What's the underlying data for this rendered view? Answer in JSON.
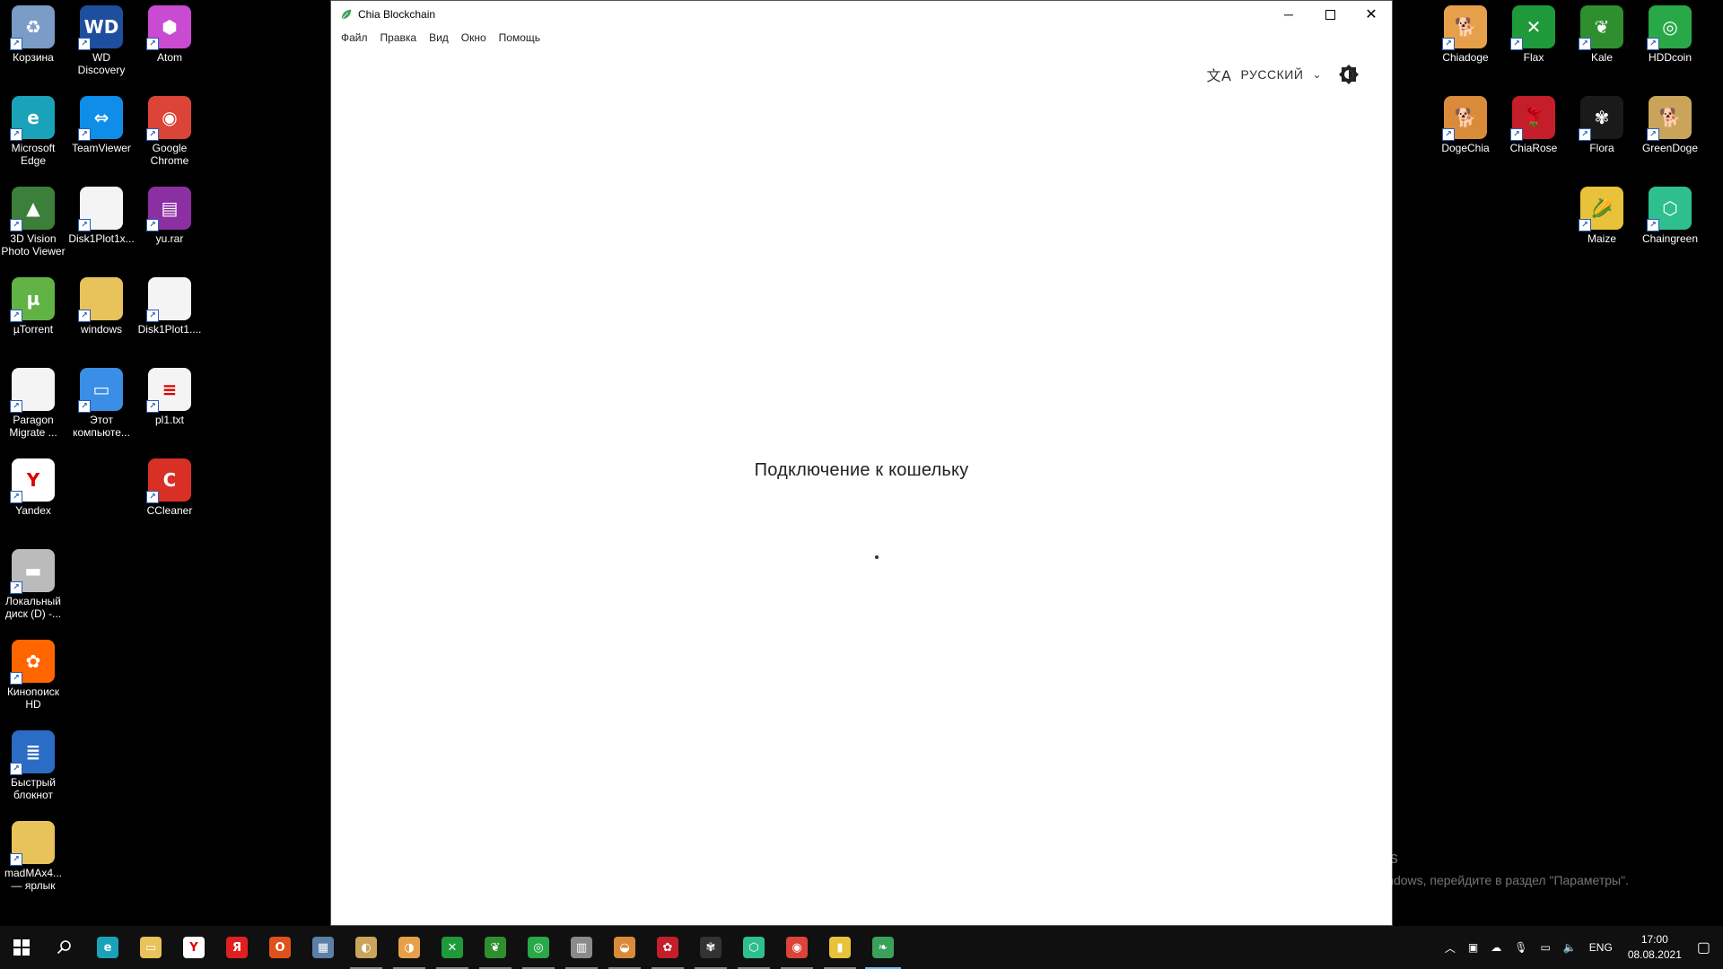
{
  "desktop_left": [
    {
      "label": "Корзина",
      "icon": "recycle-bin-icon",
      "color": "#7a9cc6",
      "glyph": "♻"
    },
    {
      "label": "WD Discovery",
      "icon": "wd-discovery-icon",
      "color": "#1e4e9e",
      "glyph": "WD"
    },
    {
      "label": "Atom",
      "icon": "atom-icon",
      "color": "#c84bd1",
      "glyph": "⬢"
    },
    {
      "label": "Microsoft Edge",
      "icon": "edge-icon",
      "color": "#1aa3b8",
      "glyph": "e"
    },
    {
      "label": "TeamViewer",
      "icon": "teamviewer-icon",
      "color": "#0e8ee9",
      "glyph": "⇔"
    },
    {
      "label": "Google Chrome",
      "icon": "chrome-icon",
      "color": "#db4437",
      "glyph": "◉"
    },
    {
      "label": "3D Vision Photo Viewer",
      "icon": "3d-vision-icon",
      "color": "#3b7f3b",
      "glyph": "▲"
    },
    {
      "label": "Disk1Plot1x...",
      "icon": "document-icon",
      "color": "#f4f4f4",
      "glyph": ""
    },
    {
      "label": "yu.rar",
      "icon": "winrar-icon",
      "color": "#8b2fa3",
      "glyph": "▤"
    },
    {
      "label": "µTorrent",
      "icon": "utorrent-icon",
      "color": "#62b346",
      "glyph": "µ"
    },
    {
      "label": "windows",
      "icon": "folder-icon",
      "color": "#e8c25a",
      "glyph": ""
    },
    {
      "label": "Disk1Plot1....",
      "icon": "document-icon",
      "color": "#f4f4f4",
      "glyph": ""
    },
    {
      "label": "Paragon Migrate ...",
      "icon": "document-icon",
      "color": "#f4f4f4",
      "glyph": ""
    },
    {
      "label": "Этот компьюте...",
      "icon": "computer-icon",
      "color": "#3a8ee6",
      "glyph": "▭"
    },
    {
      "label": "pl1.txt",
      "icon": "text-file-icon",
      "color": "#f4f4f4",
      "glyph": "≡"
    },
    {
      "label": "Yandex",
      "icon": "yandex-icon",
      "color": "#ffffff",
      "glyph": "Y"
    },
    {
      "label": "CCleaner",
      "icon": "ccleaner-icon",
      "color": "#d93025",
      "glyph": "C"
    },
    {
      "label": "Локальный диск (D) -...",
      "icon": "drive-icon",
      "color": "#bbbbbb",
      "glyph": "▬"
    },
    {
      "label": "Кинопоиск HD",
      "icon": "kinopoisk-icon",
      "color": "#ff6600",
      "glyph": "✿"
    },
    {
      "label": "Быстрый блокнот",
      "icon": "notepad-icon",
      "color": "#2b6cc4",
      "glyph": "≣"
    },
    {
      "label": "madMAx4... — ярлык",
      "icon": "folder-icon",
      "color": "#e8c25a",
      "glyph": ""
    }
  ],
  "desktop_right": [
    {
      "label": "Chiadoge",
      "icon": "chiadoge-icon",
      "color": "#e7a04a",
      "glyph": "🐕"
    },
    {
      "label": "Flax",
      "icon": "flax-icon",
      "color": "#1f9a3a",
      "glyph": "✕"
    },
    {
      "label": "Kale",
      "icon": "kale-icon",
      "color": "#2f8f2f",
      "glyph": "❦"
    },
    {
      "label": "HDDcoin",
      "icon": "hddcoin-icon",
      "color": "#29a847",
      "glyph": "◎"
    },
    {
      "label": "DogeChia",
      "icon": "dogechia-icon",
      "color": "#d98b3a",
      "glyph": "🐕"
    },
    {
      "label": "ChiaRose",
      "icon": "chiarose-icon",
      "color": "#c41e2a",
      "glyph": "🌹"
    },
    {
      "label": "Flora",
      "icon": "flora-icon",
      "color": "#1a1a1a",
      "glyph": "✾"
    },
    {
      "label": "GreenDoge",
      "icon": "greendoge-icon",
      "color": "#c9a45a",
      "glyph": "🐕"
    },
    {
      "label": "Maize",
      "icon": "maize-icon",
      "color": "#e8c23a",
      "glyph": "🌽"
    },
    {
      "label": "Chaingreen",
      "icon": "chaingreen-icon",
      "color": "#2fbf8f",
      "glyph": "⬡"
    }
  ],
  "window": {
    "title": "Chia Blockchain",
    "menu": [
      "Файл",
      "Правка",
      "Вид",
      "Окно",
      "Помощь"
    ],
    "language_label": "РУССКИЙ",
    "status_text": "Подключение к кошельку"
  },
  "watermark": {
    "heading": "Активация Windows",
    "sub": "Чтобы активировать Windows, перейдите в раздел \"Параметры\"."
  },
  "taskbar": {
    "apps": [
      {
        "name": "taskbar-edge",
        "color": "#1aa3b8",
        "glyph": "e"
      },
      {
        "name": "taskbar-explorer",
        "color": "#e8c25a",
        "glyph": "▭"
      },
      {
        "name": "taskbar-yandex-browser",
        "color": "#ffffff",
        "glyph": "Y"
      },
      {
        "name": "taskbar-yandex",
        "color": "#e02020",
        "glyph": "Я"
      },
      {
        "name": "taskbar-office",
        "color": "#e0521c",
        "glyph": "O"
      },
      {
        "name": "taskbar-calculator",
        "color": "#5b7fa6",
        "glyph": "▦"
      },
      {
        "name": "taskbar-greendoge",
        "color": "#c9a45a",
        "glyph": "◐"
      },
      {
        "name": "taskbar-chiadoge",
        "color": "#e7a04a",
        "glyph": "◑"
      },
      {
        "name": "taskbar-flax",
        "color": "#1f9a3a",
        "glyph": "✕"
      },
      {
        "name": "taskbar-kale",
        "color": "#2f8f2f",
        "glyph": "❦"
      },
      {
        "name": "taskbar-hddcoin",
        "color": "#29a847",
        "glyph": "◎"
      },
      {
        "name": "taskbar-app-grey",
        "color": "#8a8a8a",
        "glyph": "▥"
      },
      {
        "name": "taskbar-dogechia",
        "color": "#d98b3a",
        "glyph": "◒"
      },
      {
        "name": "taskbar-chiarose",
        "color": "#c41e2a",
        "glyph": "✿"
      },
      {
        "name": "taskbar-flora",
        "color": "#333333",
        "glyph": "✾"
      },
      {
        "name": "taskbar-chaingreen",
        "color": "#2fbf8f",
        "glyph": "⬡"
      },
      {
        "name": "taskbar-chrome",
        "color": "#db4437",
        "glyph": "◉"
      },
      {
        "name": "taskbar-maize",
        "color": "#e8c23a",
        "glyph": "▮"
      },
      {
        "name": "taskbar-chia",
        "color": "#3aa15a",
        "glyph": "❧"
      }
    ],
    "lang": "ENG",
    "time": "17:00",
    "date": "08.08.2021"
  }
}
